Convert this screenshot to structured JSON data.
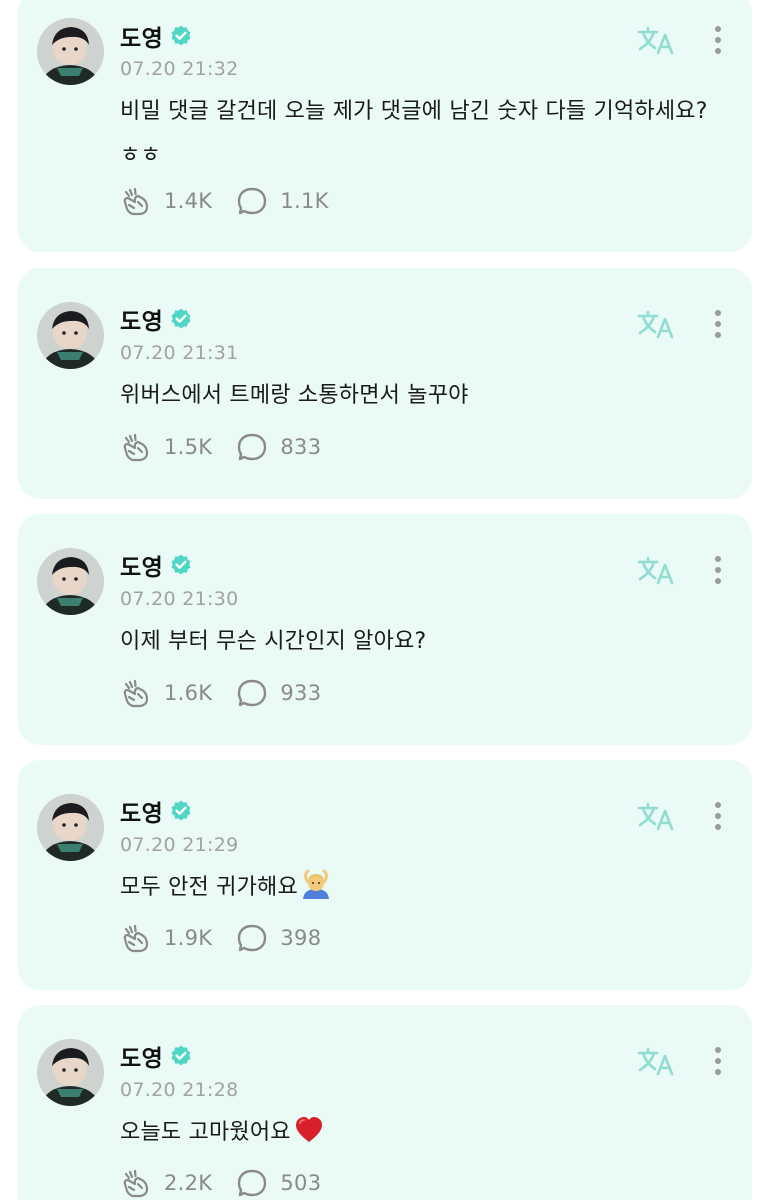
{
  "colors": {
    "card_background": "#eafaf6",
    "verified_badge": "#4fd6c5",
    "icon_stroke": "#8a8a8a",
    "translate_icon": "#90ddd2",
    "timestamp_text": "#a2a2a2"
  },
  "icons": {
    "verified": "verified-badge-icon",
    "translate": "translate-icon",
    "more": "more-vertical-icon",
    "likes": "cheer-hands-icon",
    "comments": "comment-bubble-icon"
  },
  "posts": [
    {
      "author": "도영",
      "timestamp": "07.20 21:32",
      "text": "비밀 댓글 갈건데 오늘 제가 댓글에 남긴 숫자 다들 기억하세요? ㅎㅎ",
      "likes": "1.4K",
      "comments": "1.1K"
    },
    {
      "author": "도영",
      "timestamp": "07.20 21:31",
      "text": "위버스에서 트메랑 소통하면서 놀꾸야",
      "likes": "1.5K",
      "comments": "833"
    },
    {
      "author": "도영",
      "timestamp": "07.20 21:30",
      "text": "이제 부터 무슨 시간인지 알아요?",
      "likes": "1.6K",
      "comments": "933"
    },
    {
      "author": "도영",
      "timestamp": "07.20 21:29",
      "text": "모두 안전 귀가해요",
      "emoji": "person-gesturing-ok-emoji",
      "likes": "1.9K",
      "comments": "398"
    },
    {
      "author": "도영",
      "timestamp": "07.20 21:28",
      "text": "오늘도 고마웠어요",
      "emoji": "red-heart-emoji",
      "likes": "2.2K",
      "comments": "503"
    }
  ]
}
